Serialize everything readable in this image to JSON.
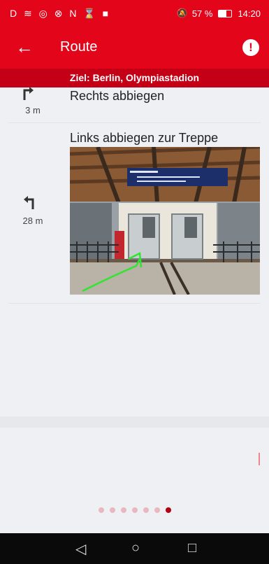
{
  "status_bar": {
    "left_icons": "D ≋ ◎ ⊗ N ⌛ ■",
    "mute_icon": "🔕",
    "battery_text": "57 %",
    "time": "14:20"
  },
  "app_bar": {
    "title": "Route",
    "alert_symbol": "!"
  },
  "destination": "Ziel: Berlin, Olympiastadion",
  "steps": [
    {
      "instruction": "Rechts abbiegen",
      "distance": "3 m",
      "icon": "turn-right-icon"
    },
    {
      "instruction": "Links abbiegen zur Treppe",
      "distance": "28 m",
      "icon": "turn-left-icon"
    }
  ],
  "pagination": {
    "count": 7,
    "active_index": 6
  },
  "nav_bar": {
    "back": "◁",
    "home": "○",
    "recents": "□"
  },
  "colors": {
    "brand_red": "#e3061b",
    "dest_red": "#c30015"
  }
}
